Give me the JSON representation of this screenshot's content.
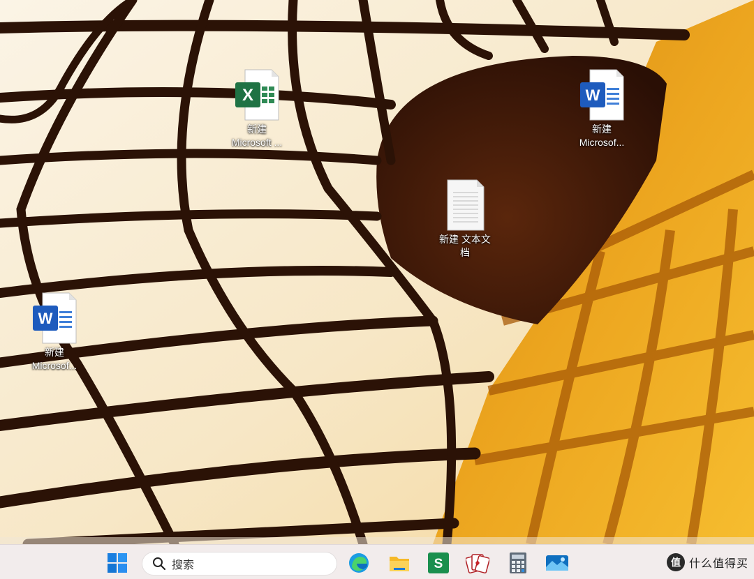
{
  "desktop": {
    "icons": [
      {
        "app": "excel",
        "label": "新建\nMicrosoft ..."
      },
      {
        "app": "word",
        "label": "新建\nMicrosof..."
      },
      {
        "app": "text",
        "label": "新建 文本文\n档"
      },
      {
        "app": "word",
        "label": "新建\nMicrosof..."
      }
    ]
  },
  "taskbar": {
    "start_icon": "windows-logo-icon",
    "search_placeholder": "搜索",
    "pinned_apps": [
      {
        "name": "edge",
        "icon": "edge-icon"
      },
      {
        "name": "file-explorer",
        "icon": "folder-icon"
      },
      {
        "name": "wps-spreadsheet",
        "icon": "spreadsheet-s-icon",
        "glyph": "S"
      },
      {
        "name": "solitaire",
        "icon": "cards-icon"
      },
      {
        "name": "calculator",
        "icon": "calculator-icon"
      },
      {
        "name": "photos",
        "icon": "photos-icon"
      }
    ],
    "watermark_badge": "值",
    "watermark_text": "什么值得买"
  },
  "colors": {
    "excel_green": "#1f7244",
    "word_blue": "#1e5bbd",
    "taskbar_bg": "#f2ecec",
    "wallpaper_gold": "#e8a21c"
  }
}
